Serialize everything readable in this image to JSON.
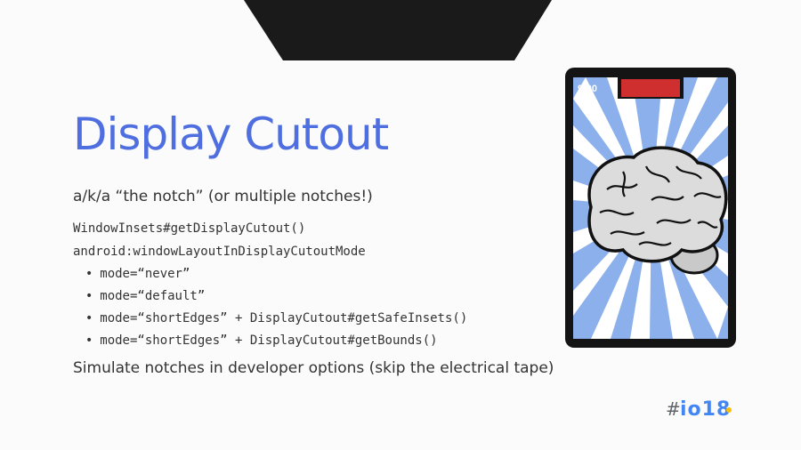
{
  "slide": {
    "title": "Display Cutout",
    "subtitle": "a/k/a “the notch” (or multiple notches!)",
    "code_lines": [
      "WindowInsets#getDisplayCutout()",
      "android:windowLayoutInDisplayCutoutMode"
    ],
    "bullets": [
      "mode=“never”",
      "mode=“default”",
      "mode=“shortEdges” + DisplayCutout#getSafeInsets()",
      "mode=“shortEdges” + DisplayCutout#getBounds()"
    ],
    "bullet_glyph": "•",
    "footer": "Simulate notches in developer options (skip the electrical tape)"
  },
  "phone": {
    "status_time": "9:00",
    "screen_color": "#8cb0ec",
    "notch_color": "#cf2f2f",
    "icon": "brain-icon"
  },
  "logo": {
    "hash": "#",
    "text": "io18",
    "colors": [
      "#4285f4",
      "#ea4335",
      "#fbbc05",
      "#34a853"
    ]
  },
  "colors": {
    "title": "#4f6fe0",
    "body_text": "#333333",
    "top_shape": "#1a1a1a"
  }
}
